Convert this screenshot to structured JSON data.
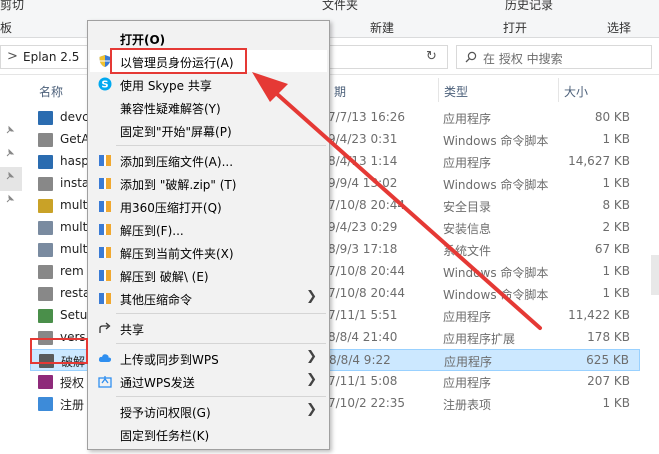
{
  "ribbon": {
    "left_label": "剪切",
    "left_sub": "板",
    "center_label": "新建",
    "open_label": "打开",
    "select_label": "选择",
    "history_label": "历史记录",
    "top_left": "文件夹"
  },
  "address": {
    "chevron": ">",
    "path": "Eplan 2.5",
    "refresh": "↻"
  },
  "search": {
    "placeholder": "在 授权 中搜索"
  },
  "columns": {
    "name": "名称",
    "date": "期",
    "type": "类型",
    "size": "大小"
  },
  "files": [
    {
      "name": "devc",
      "date": "7/7/13 16:26",
      "type": "应用程序",
      "size": "80 KB",
      "icon": "exe-icon",
      "color": "#2b6cb0"
    },
    {
      "name": "GetA",
      "date": "9/4/23 0:31",
      "type": "Windows 命令脚本",
      "size": "1 KB",
      "icon": "script-icon",
      "color": "#888"
    },
    {
      "name": "hasp",
      "date": "8/4/13 1:14",
      "type": "应用程序",
      "size": "14,627 KB",
      "icon": "exe-icon",
      "color": "#2b6cb0"
    },
    {
      "name": "insta",
      "date": "9/9/4 13:02",
      "type": "Windows 命令脚本",
      "size": "1 KB",
      "icon": "script-icon",
      "color": "#888"
    },
    {
      "name": "mult",
      "date": "7/10/8 20:44",
      "type": "安全目录",
      "size": "8 KB",
      "icon": "catalog-icon",
      "color": "#c9a227"
    },
    {
      "name": "mult",
      "date": "9/4/23 0:29",
      "type": "安装信息",
      "size": "2 KB",
      "icon": "setup-info-icon",
      "color": "#7a8ba0"
    },
    {
      "name": "mult",
      "date": "8/9/3 17:18",
      "type": "系统文件",
      "size": "67 KB",
      "icon": "system-file-icon",
      "color": "#7a8ba0"
    },
    {
      "name": "rem",
      "date": "7/10/8 20:44",
      "type": "Windows 命令脚本",
      "size": "1 KB",
      "icon": "script-icon",
      "color": "#888"
    },
    {
      "name": "resta",
      "date": "7/10/8 20:44",
      "type": "Windows 命令脚本",
      "size": "1 KB",
      "icon": "script-icon",
      "color": "#888"
    },
    {
      "name": "Setu",
      "date": "7/11/1 5:51",
      "type": "应用程序",
      "size": "11,422 KB",
      "icon": "setup-icon",
      "color": "#4a8f4a"
    },
    {
      "name": "vers",
      "date": "8/8/4 21:40",
      "type": "应用程序扩展",
      "size": "178 KB",
      "icon": "dll-icon",
      "color": "#888"
    },
    {
      "name": "破解",
      "date": "8/8/4 9:22",
      "type": "应用程序",
      "size": "625 KB",
      "icon": "crack-icon",
      "color": "#5a5a5a",
      "selected": true
    },
    {
      "name": "授权",
      "date": "7/11/1 5:08",
      "type": "应用程序",
      "size": "207 KB",
      "icon": "license-icon",
      "color": "#8e2a7a"
    },
    {
      "name": "注册",
      "date": "7/10/2 22:35",
      "type": "注册表项",
      "size": "1 KB",
      "icon": "registry-icon",
      "color": "#3d8bd9"
    }
  ],
  "menu": {
    "open": "打开(O)",
    "run_as_admin": "以管理员身份运行(A)",
    "skype": "使用 Skype 共享",
    "compat": "兼容性疑难解答(Y)",
    "pin_start": "固定到\"开始\"屏幕(P)",
    "add_archive": "添加到压缩文件(A)...",
    "add_zip": "添加到 \"破解.zip\" (T)",
    "open_360": "用360压缩打开(Q)",
    "extract_to": "解压到(F)...",
    "extract_here": "解压到当前文件夹(X)",
    "extract_folder": "解压到 破解\\ (E)",
    "other_cmds": "其他压缩命令",
    "share": "共享",
    "upload_wps": "上传或同步到WPS",
    "send_wps": "通过WPS发送",
    "grant_access": "授予访问权限(G)",
    "pin_taskbar": "固定到任务栏(K)",
    "submenu_arrow": "❯"
  },
  "colors": {
    "highlight_red": "#e53935",
    "selection": "#cce8ff"
  }
}
